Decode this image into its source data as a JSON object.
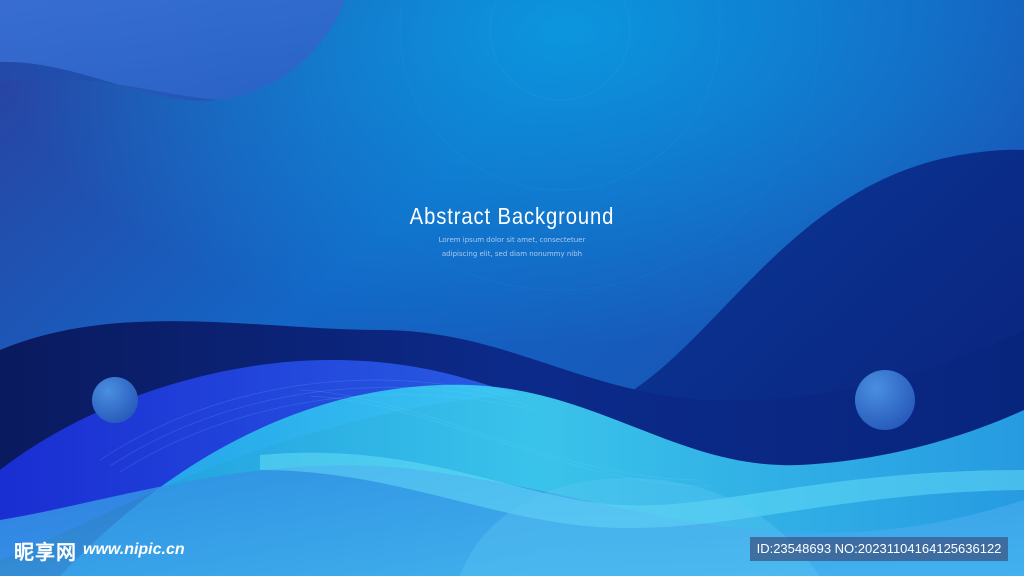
{
  "hero": {
    "title": "Abstract Background",
    "subtitle_line1": "Lorem ipsum dolor sit amet, consectetuer",
    "subtitle_line2": "adipiscing elit, sed diam nonummy nibh"
  },
  "watermark": {
    "site_cn": "昵享网",
    "site_url": "www.nipic.cn",
    "id_text": "ID:23548693 NO:20231104164125636122"
  },
  "colors": {
    "base_blue": "#0d4fae",
    "deep_navy": "#0a1f6e",
    "cyan_light": "#3fd4f5",
    "sky_blue": "#2a8fe0",
    "circle_blue": "#2e6fc8"
  }
}
